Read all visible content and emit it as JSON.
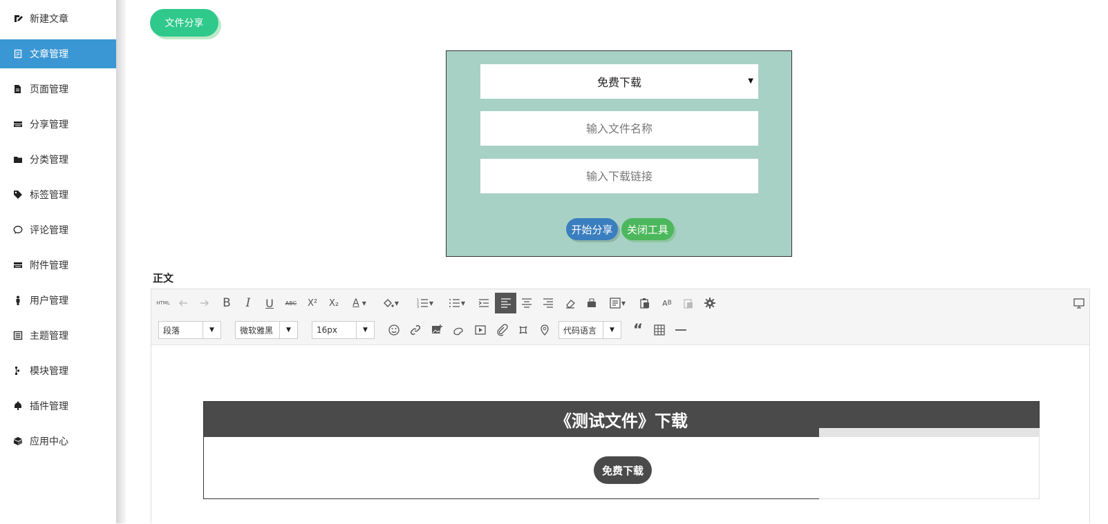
{
  "sidebar": {
    "items": [
      {
        "label": "新建文章",
        "icon": "new-article-icon"
      },
      {
        "label": "文章管理",
        "icon": "article-manage-icon",
        "active": true
      },
      {
        "label": "页面管理",
        "icon": "page-manage-icon"
      },
      {
        "label": "分享管理",
        "icon": "share-manage-icon"
      },
      {
        "label": "分类管理",
        "icon": "folder-icon"
      },
      {
        "label": "标签管理",
        "icon": "tag-icon"
      },
      {
        "label": "评论管理",
        "icon": "comment-icon"
      },
      {
        "label": "附件管理",
        "icon": "attachment-manage-icon"
      },
      {
        "label": "用户管理",
        "icon": "user-icon"
      },
      {
        "label": "主题管理",
        "icon": "theme-icon"
      },
      {
        "label": "模块管理",
        "icon": "module-icon"
      },
      {
        "label": "插件管理",
        "icon": "plugin-icon"
      },
      {
        "label": "应用中心",
        "icon": "app-center-icon"
      }
    ],
    "active_color": "#3a97d4"
  },
  "share_toggle": {
    "label": "文件分享",
    "color": "#2fc98b"
  },
  "share_panel": {
    "background": "#a7d1c4",
    "download_type": "免费下载",
    "file_name_placeholder": "输入文件名称",
    "link_placeholder": "输入下载链接",
    "start_label": "开始分享",
    "close_label": "关闭工具"
  },
  "body_label": "正文",
  "toolbar": {
    "html_label": "HTML",
    "paragraph_select": "段落",
    "font_select": "微软雅黑",
    "size_select": "16px",
    "code_lang_select": "代码语言"
  },
  "content": {
    "box_title": "《测试文件》下载",
    "box_button": "免费下载"
  }
}
